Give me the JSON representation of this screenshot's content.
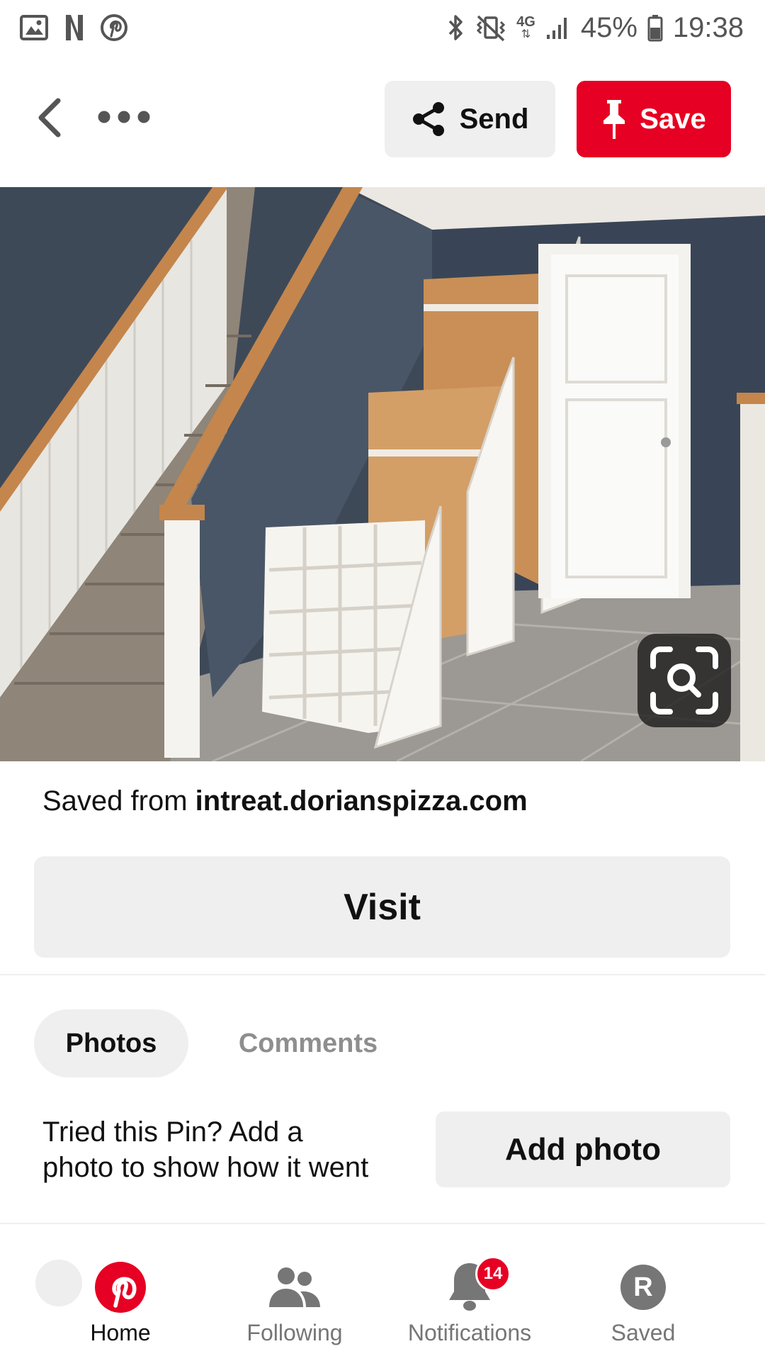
{
  "status_bar": {
    "battery": "45%",
    "time": "19:38",
    "network": "4G",
    "left_icons": [
      "gallery-icon",
      "netflix-icon",
      "pinterest-icon"
    ],
    "right_icons": [
      "bluetooth-icon",
      "vibrate-mute-icon",
      "signal-icon",
      "battery-icon"
    ]
  },
  "topnav": {
    "send_label": "Send",
    "save_label": "Save"
  },
  "pin": {
    "source_prefix": "Saved from ",
    "source_domain": "intreat.dorianspizza.com",
    "visit_label": "Visit"
  },
  "tabs": [
    {
      "label": "Photos",
      "active": true
    },
    {
      "label": "Comments",
      "active": false
    }
  ],
  "tried": {
    "line1": "Tried this Pin? Add a",
    "line2": "photo to show how it went",
    "button_label": "Add photo"
  },
  "bottom_nav": [
    {
      "label": "Home",
      "active": true
    },
    {
      "label": "Following",
      "active": false
    },
    {
      "label": "Notifications",
      "active": false,
      "badge": "14"
    },
    {
      "label": "Saved",
      "active": false,
      "avatar_letter": "R"
    }
  ],
  "colors": {
    "brand_red": "#e60023",
    "button_gray": "#efefef",
    "muted_text": "#767676"
  }
}
